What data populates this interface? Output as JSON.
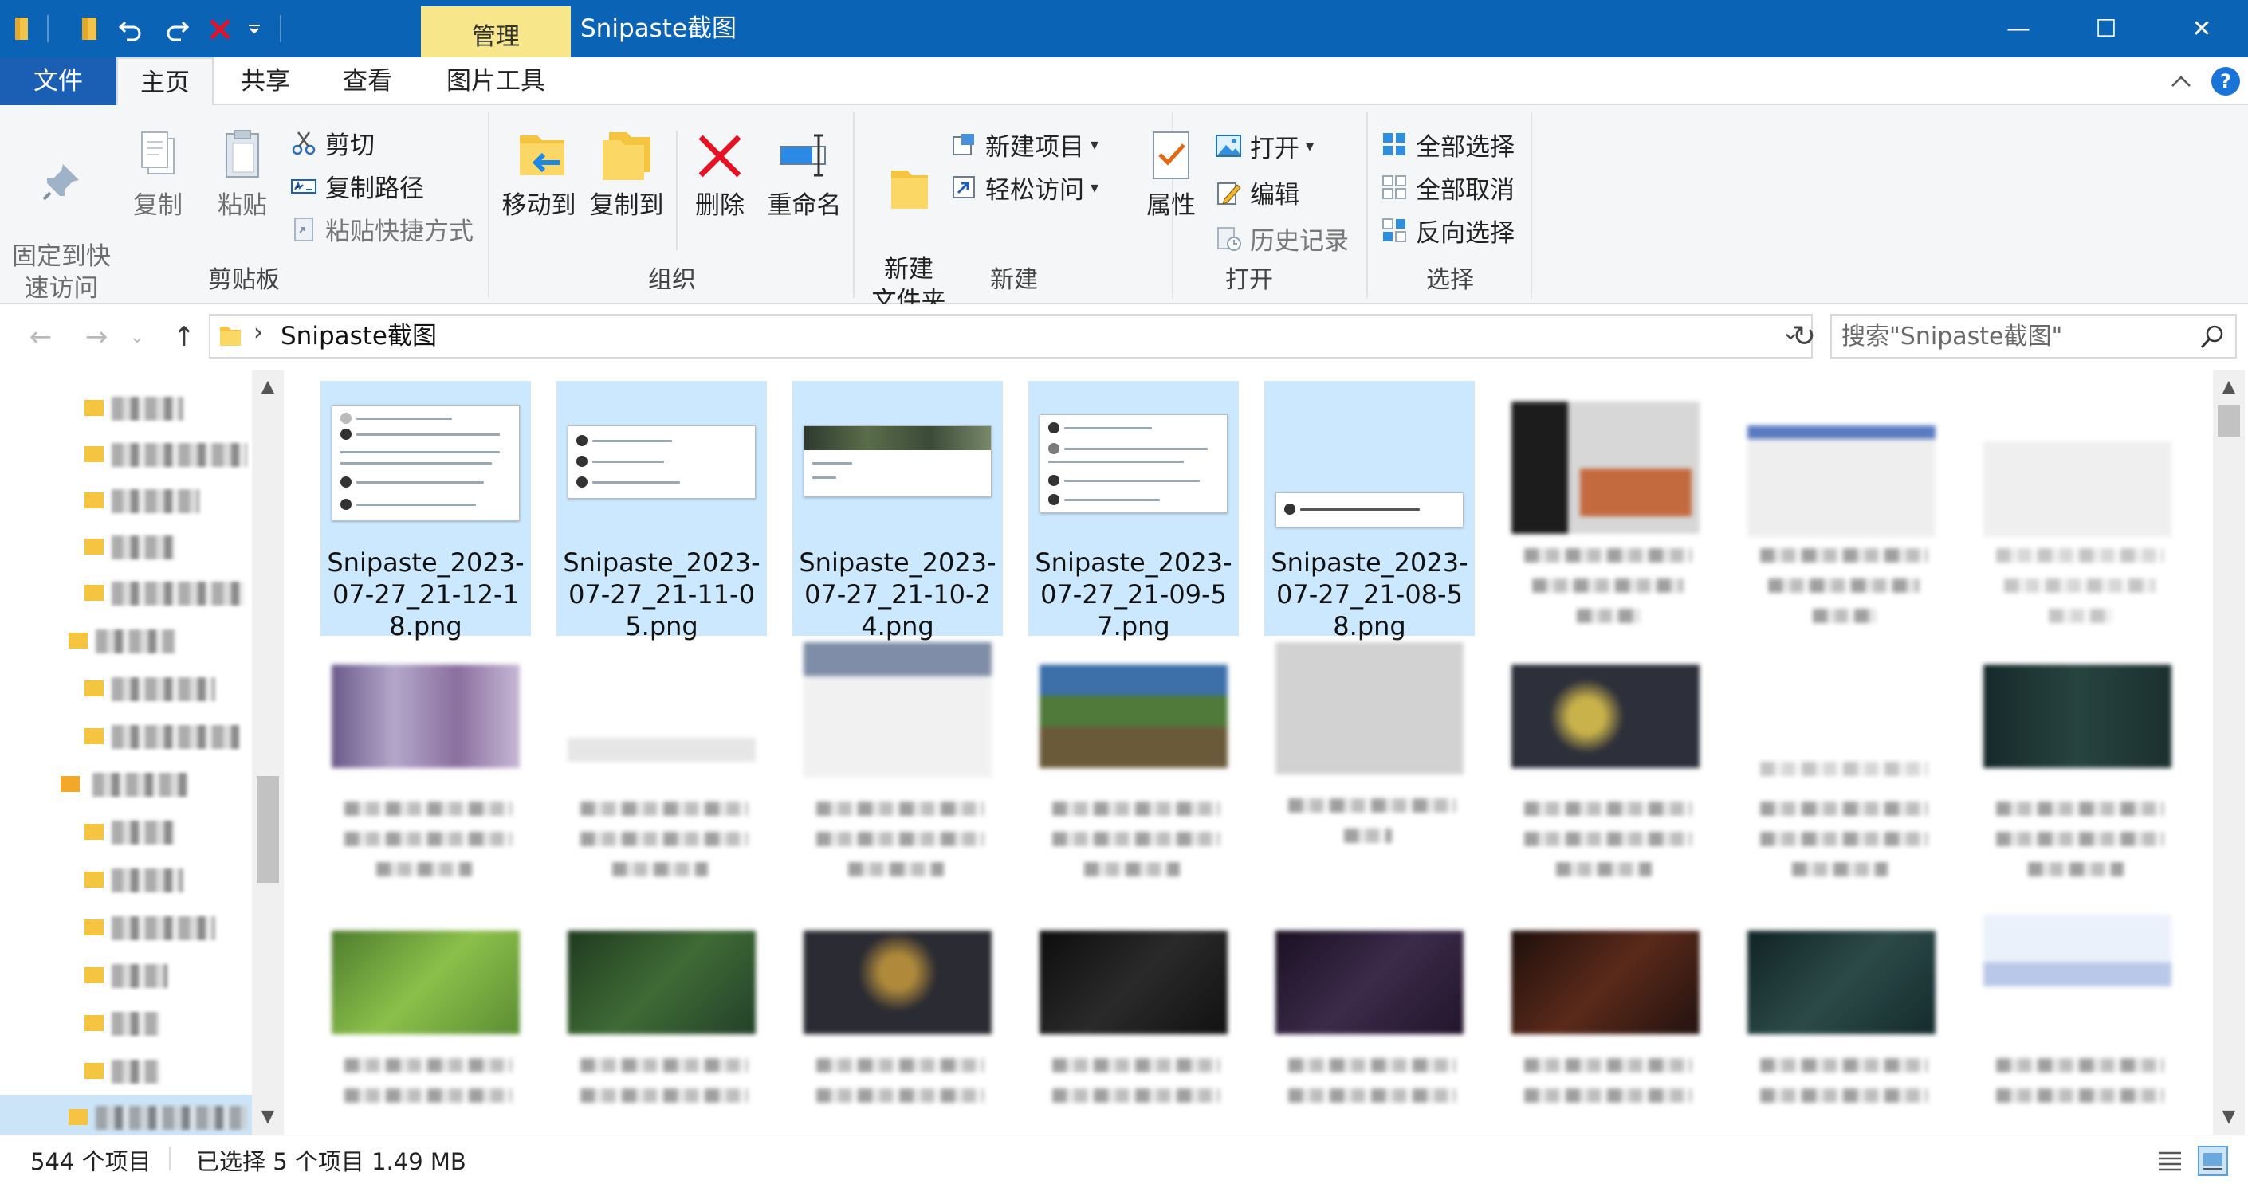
{
  "window": {
    "title": "Snipaste截图",
    "context_tab": "管理",
    "minimize_glyph": "—",
    "maximize_glyph": "☐",
    "close_glyph": "✕"
  },
  "ribbon_tabs": {
    "file": "文件",
    "home": "主页",
    "share": "共享",
    "view": "查看",
    "picture_tools": "图片工具"
  },
  "clipboard": {
    "pin": "固定到快\n速访问",
    "copy": "复制",
    "paste": "粘贴",
    "cut": "剪切",
    "copy_path": "复制路径",
    "paste_shortcut": "粘贴快捷方式",
    "label": "剪贴板"
  },
  "organize": {
    "move_to": "移动到",
    "copy_to": "复制到",
    "delete": "删除",
    "rename": "重命名",
    "label": "组织"
  },
  "new": {
    "new_folder": "新建\n文件夹",
    "new_item": "新建项目",
    "easy_access": "轻松访问",
    "label": "新建"
  },
  "open": {
    "properties": "属性",
    "open": "打开",
    "edit": "编辑",
    "history": "历史记录",
    "label": "打开"
  },
  "select": {
    "select_all": "全部选择",
    "select_none": "全部取消",
    "invert": "反向选择",
    "label": "选择"
  },
  "address": {
    "path": "Snipaste截图",
    "search_placeholder": "搜索\"Snipaste截图\""
  },
  "files_selected": [
    {
      "name": "Snipaste_2023-07-27_21-12-18.png"
    },
    {
      "name": "Snipaste_2023-07-27_21-11-05.png"
    },
    {
      "name": "Snipaste_2023-07-27_21-10-24.png"
    },
    {
      "name": "Snipaste_2023-07-27_21-09-57.png"
    },
    {
      "name": "Snipaste_2023-07-27_21-08-58.png"
    }
  ],
  "status": {
    "item_count": "544 个项目",
    "selected": "已选择 5 个项目  1.49 MB"
  },
  "colors": {
    "titlebar": "#0b63b6",
    "manage_tab": "#f7e78a",
    "selection": "#cce8ff"
  }
}
